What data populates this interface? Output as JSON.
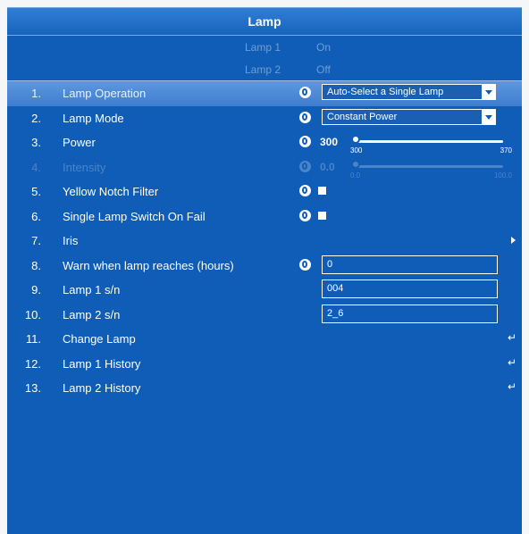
{
  "panel_title": "Lamp",
  "status": [
    {
      "label": "Lamp 1",
      "value": "On"
    },
    {
      "label": "Lamp 2",
      "value": "Off"
    }
  ],
  "rows": {
    "r1": {
      "num": "1.",
      "label": "Lamp Operation",
      "dropdown": "Auto-Select a Single Lamp"
    },
    "r2": {
      "num": "2.",
      "label": "Lamp Mode",
      "dropdown": "Constant Power"
    },
    "r3": {
      "num": "3.",
      "label": "Power",
      "value": "300",
      "slider_min": "300",
      "slider_max": "370",
      "slider_fraction": 0.0
    },
    "r4": {
      "num": "4.",
      "label": "Intensity",
      "value": "0.0",
      "slider_min": "0.0",
      "slider_max": "100.0",
      "slider_fraction": 0.0
    },
    "r5": {
      "num": "5.",
      "label": "Yellow Notch Filter",
      "checked": false
    },
    "r6": {
      "num": "6.",
      "label": "Single Lamp Switch On Fail",
      "checked": false
    },
    "r7": {
      "num": "7.",
      "label": "Iris"
    },
    "r8": {
      "num": "8.",
      "label": "Warn when lamp reaches (hours)",
      "field": "0"
    },
    "r9": {
      "num": "9.",
      "label": "Lamp 1 s/n",
      "field": "004"
    },
    "r10": {
      "num": "10.",
      "label": "Lamp 2 s/n",
      "field": "2_6"
    },
    "r11": {
      "num": "11.",
      "label": "Change Lamp"
    },
    "r12": {
      "num": "12.",
      "label": "Lamp 1 History"
    },
    "r13": {
      "num": "13.",
      "label": "Lamp 2 History"
    }
  },
  "icons": {
    "globe": "globe-icon",
    "submenu": "chevron-right-icon",
    "action": "enter-icon",
    "dropdown": "chevron-down-icon"
  },
  "colors": {
    "panel_bg": "#0f5db7",
    "selected_row": "#4a87d6",
    "disabled_text": "#4b84c8",
    "status_text": "#6d9fd8"
  }
}
